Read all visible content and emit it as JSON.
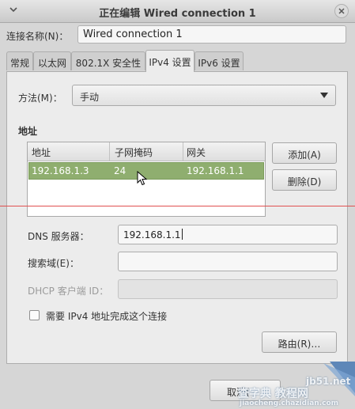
{
  "window": {
    "title": "正在编辑 Wired connection 1"
  },
  "connection": {
    "name_label": "连接名称(N)：",
    "name_value": "Wired connection 1"
  },
  "tabs": [
    {
      "label": "常规"
    },
    {
      "label": "以太网"
    },
    {
      "label": "802.1X 安全性"
    },
    {
      "label": "IPv4 设置",
      "active": true
    },
    {
      "label": "IPv6 设置"
    }
  ],
  "ipv4": {
    "method_label": "方法(M)：",
    "method_value": "手动",
    "addresses_heading": "地址",
    "columns": [
      "地址",
      "子网掩码",
      "网关"
    ],
    "rows": [
      {
        "address": "192.168.1.3",
        "netmask": "24",
        "gateway": "192.168.1.1",
        "selected": true
      }
    ],
    "add_label": "添加(A)",
    "delete_label": "删除(D)",
    "dns_label": "DNS 服务器：",
    "dns_value": "192.168.1.1",
    "search_label": "搜索域(E)：",
    "search_value": "",
    "dhcp_label": "DHCP 客户端 ID：",
    "dhcp_value": "",
    "require_ipv4_label": "需要 IPv4 地址完成这个连接",
    "require_ipv4_checked": false,
    "routes_label": "路由(R)…"
  },
  "footer": {
    "cancel_label": "取消("
  },
  "watermark": {
    "line1": "jb51.net",
    "line2": "查字典 教程网",
    "line3": "jiaocheng.chazidian.com"
  },
  "colors": {
    "selection": "#8fae6f",
    "annotation_line": "#e05050"
  }
}
